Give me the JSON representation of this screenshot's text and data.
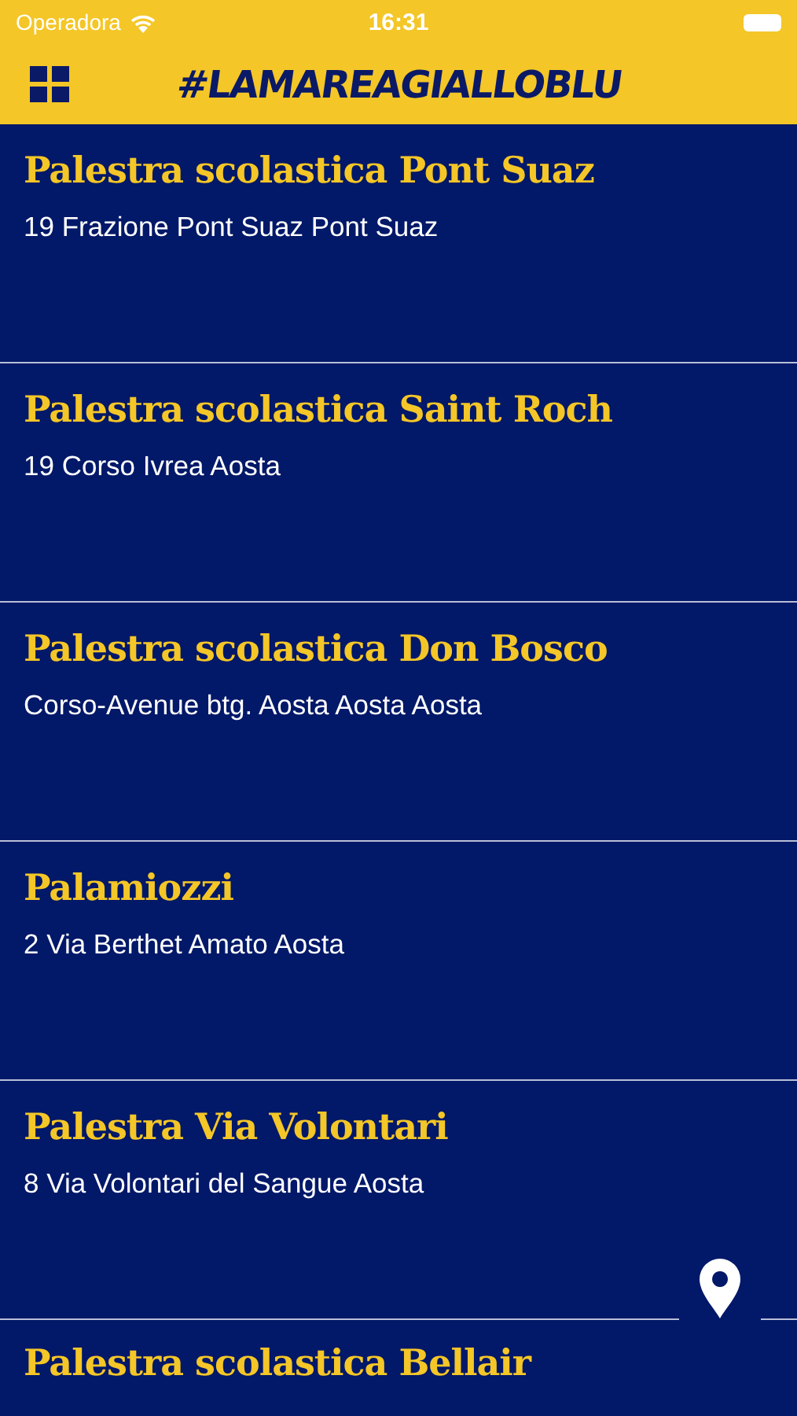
{
  "status_bar": {
    "carrier": "Operadora",
    "time": "16:31"
  },
  "header": {
    "title": "#LAMAREAGIALLOBLU"
  },
  "venues": [
    {
      "name": "Palestra scolastica Pont Suaz",
      "address": "19 Frazione Pont Suaz Pont Suaz"
    },
    {
      "name": "Palestra scolastica Saint Roch",
      "address": "19 Corso Ivrea Aosta"
    },
    {
      "name": "Palestra scolastica Don Bosco",
      "address": "Corso-Avenue btg. Aosta Aosta Aosta"
    },
    {
      "name": "Palamiozzi",
      "address": "2 Via Berthet Amato Aosta"
    },
    {
      "name": "Palestra Via Volontari",
      "address": "8 Via Volontari del Sangue Aosta"
    },
    {
      "name": "Palestra scolastica Bellair"
    }
  ]
}
